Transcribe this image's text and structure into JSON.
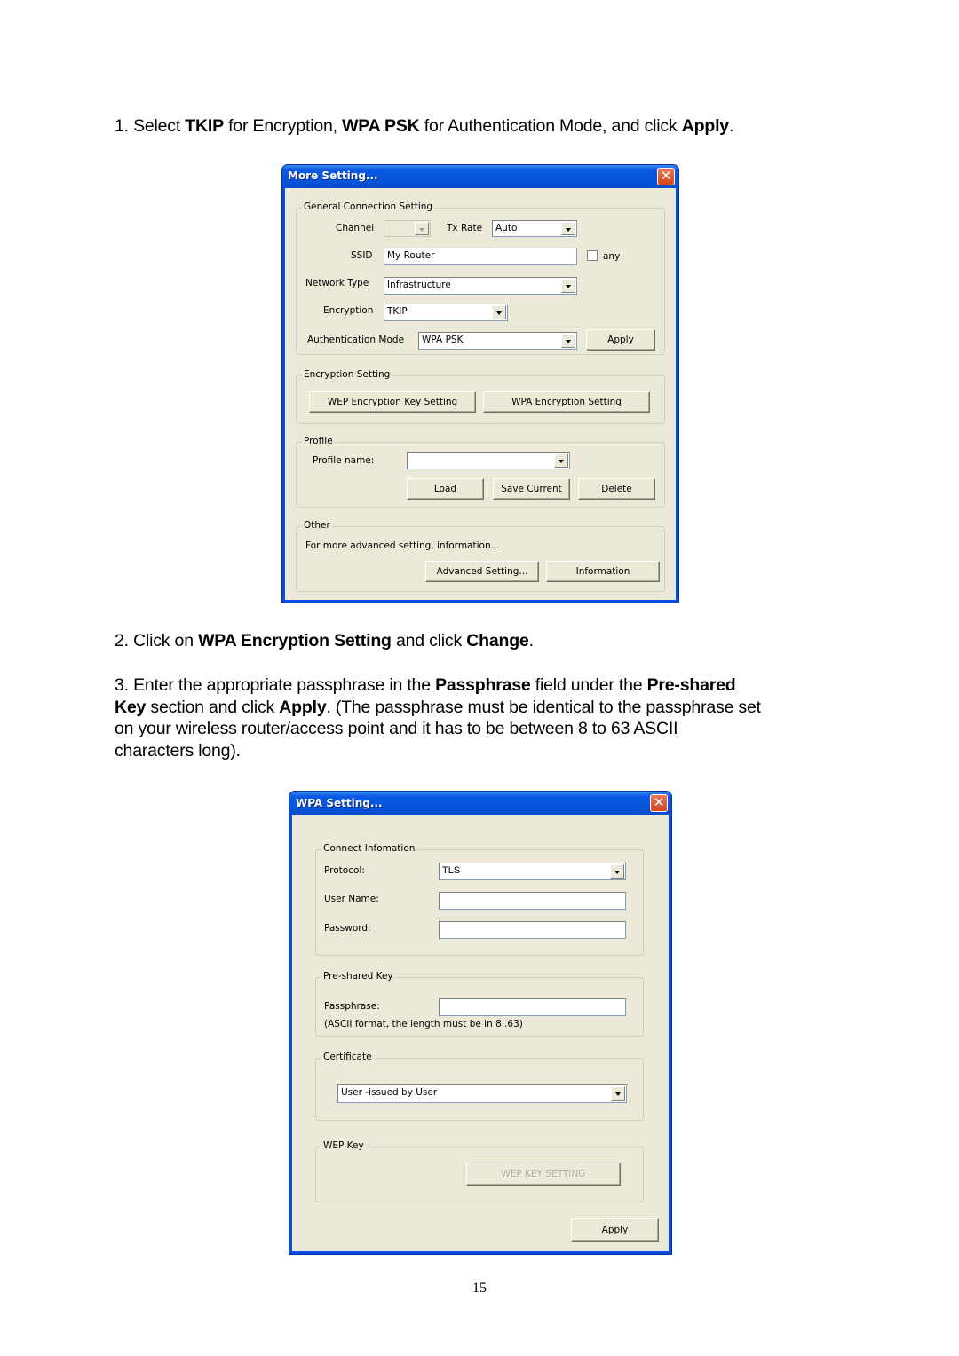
{
  "document": {
    "step1": {
      "prefix": "1. Select ",
      "b1": "TKIP",
      "t1": " for Encryption, ",
      "b2": "WPA PSK",
      "t2": " for Authentication Mode, and click ",
      "b3": "Apply",
      "t3": "."
    },
    "step2": {
      "prefix": "2. Click on ",
      "b1": "WPA Encryption Setting",
      "t1": " and click ",
      "b2": "Change",
      "t2": "."
    },
    "step3": {
      "prefix": "3. Enter the appropriate passphrase in the ",
      "b1": "Passphrase",
      "t1": " field under the ",
      "b2": "Pre-shared",
      "line2_b": "Key",
      "t2": " section and click ",
      "b3": "Apply",
      "t3": ". (The passphrase must be identical to the passphrase set",
      "line3": "on your wireless router/access point and it has to be between 8 to 63 ASCII",
      "line4": "characters long)."
    },
    "page_number": "15"
  },
  "more_setting_dialog": {
    "title": "More Setting...",
    "close_label": "✕",
    "general": {
      "legend": "General Connection Setting",
      "channel_label": "Channel",
      "channel_value": "",
      "tx_rate_label": "Tx Rate",
      "tx_rate_value": "Auto",
      "ssid_label": "SSID",
      "ssid_value": "My Router",
      "any_label": "any",
      "any_checked": false,
      "network_type_label": "Network Type",
      "network_type_value": "Infrastructure",
      "encryption_label": "Encryption",
      "encryption_value": "TKIP",
      "auth_mode_label": "Authentication Mode",
      "auth_mode_value": "WPA PSK",
      "apply_label": "Apply"
    },
    "encryption_setting": {
      "legend": "Encryption Setting",
      "wep_button": "WEP Encryption Key Setting",
      "wpa_button": "WPA Encryption Setting"
    },
    "profile": {
      "legend": "Profile",
      "name_label": "Profile name:",
      "name_value": "",
      "load_button": "Load",
      "save_button": "Save Current",
      "delete_button": "Delete"
    },
    "other": {
      "legend": "Other",
      "description": "For more advanced setting, information...",
      "advanced_button": "Advanced Setting...",
      "information_button": "Information"
    }
  },
  "wpa_setting_dialog": {
    "title": "WPA Setting...",
    "close_label": "✕",
    "connect_info": {
      "legend": "Connect Infomation",
      "protocol_label": "Protocol:",
      "protocol_value": "TLS",
      "username_label": "User Name:",
      "username_value": "",
      "password_label": "Password:",
      "password_value": ""
    },
    "pre_shared_key": {
      "legend": "Pre-shared Key",
      "passphrase_label": "Passphrase:",
      "passphrase_value": "",
      "hint": "(ASCII format, the length must be in 8..63)"
    },
    "certificate": {
      "legend": "Certificate",
      "value": "User -issued by User"
    },
    "wep_key": {
      "legend": "WEP Key",
      "button": "WEP KEY SETTING"
    },
    "apply_label": "Apply"
  }
}
